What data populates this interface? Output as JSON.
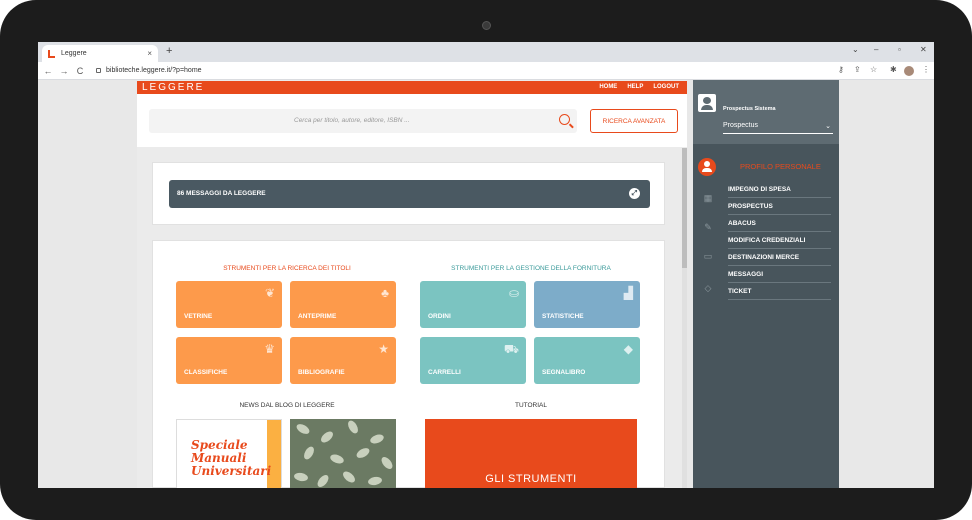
{
  "browser": {
    "tab_title": "Leggere",
    "tab_close": "×",
    "new_tab": "+",
    "url": "biblioteche.leggere.it/?p=home",
    "nav_back": "←",
    "nav_forward": "→",
    "nav_reload": "C"
  },
  "header": {
    "logo": "LEGGERE",
    "nav": [
      "HOME",
      "HELP",
      "LOGOUT"
    ]
  },
  "search": {
    "placeholder": "Cerca per titolo, autore, editore, ISBN ...",
    "advanced_label": "RICERCA AVANZATA"
  },
  "messages": {
    "label": "86 MESSAGGI DA LEGGERE"
  },
  "tools": {
    "left_title": "STRUMENTI PER LA RICERCA DEI TITOLI",
    "right_title": "STRUMENTI PER LA GESTIONE DELLA FORNITURA",
    "left_tiles": [
      {
        "label": "VETRINE",
        "icon": "leaf-icon",
        "color": "#fd9a4b"
      },
      {
        "label": "ANTEPRIME",
        "icon": "sprout-icon",
        "color": "#fd9a4b"
      },
      {
        "label": "CLASSIFICHE",
        "icon": "trophy-icon",
        "color": "#fd9a4b"
      },
      {
        "label": "BIBLIOGRAFIE",
        "icon": "star-icon",
        "color": "#fd9a4b"
      }
    ],
    "right_tiles": [
      {
        "label": "ORDINI",
        "icon": "basket-icon",
        "color": "#7bc4c1"
      },
      {
        "label": "STATISTICHE",
        "icon": "bar-chart-icon",
        "color": "#7dacc9"
      },
      {
        "label": "CARRELLI",
        "icon": "cart-icon",
        "color": "#7bc4c1"
      },
      {
        "label": "SEGNALIBRO",
        "icon": "tag-icon",
        "color": "#7bc4c1"
      }
    ]
  },
  "news": {
    "title": "NEWS DAL BLOG DI LEGGERE",
    "card1_lines": [
      "Speciale",
      "Manuali",
      "Universitari"
    ]
  },
  "tutorial": {
    "title": "TUTORIAL",
    "card_text": "GLI STRUMENTI"
  },
  "profile": {
    "user_name": "Prospectus Sistema",
    "selected_profile": "Prospectus",
    "section_title": "PROFILO PERSONALE",
    "menu": [
      "IMPEGNO DI SPESA",
      "PROSPECTUS",
      "ABACUS",
      "MODIFICA CREDENZIALI",
      "DESTINAZIONI MERCE",
      "MESSAGGI",
      "TICKET"
    ]
  },
  "colors": {
    "brand": "#e84a1c",
    "panel": "#48555c",
    "tile_orange": "#fd9a4b",
    "tile_teal": "#7bc4c1",
    "tile_blue": "#7dacc9"
  }
}
